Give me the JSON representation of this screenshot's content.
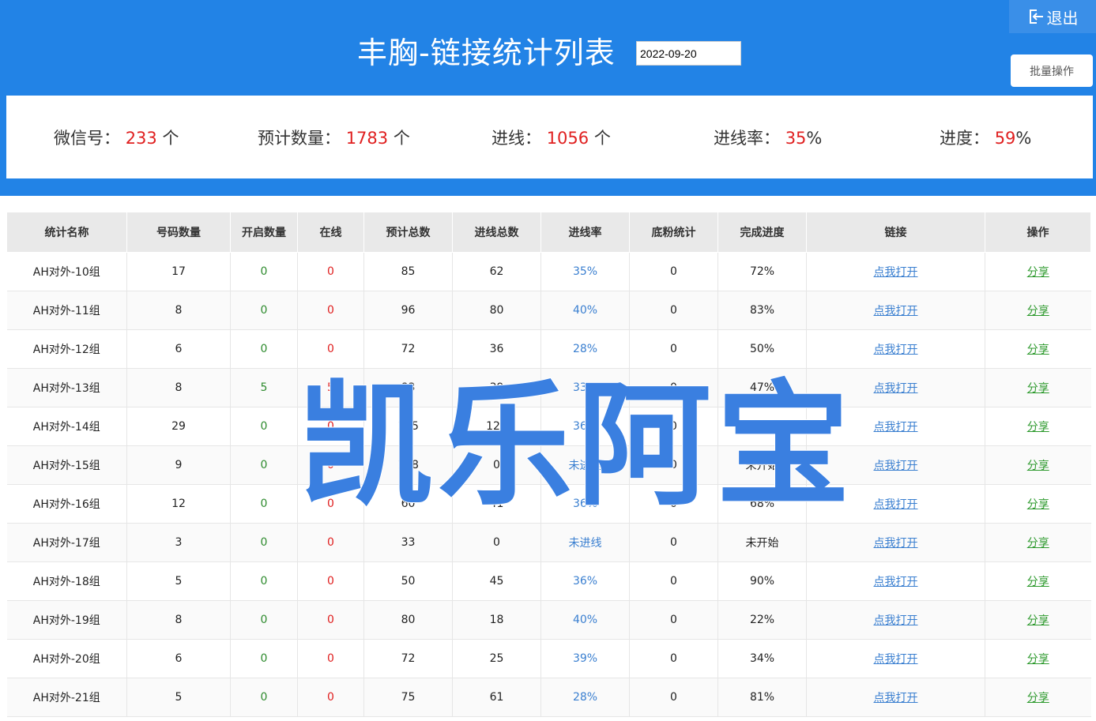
{
  "header": {
    "title": "丰胸-链接统计列表",
    "date_value": "2022-09-20",
    "logout_label": "退出",
    "logout_icon": "logout-icon",
    "batch_label": "批量操作",
    "bg_color": "#2283e6"
  },
  "stats": [
    {
      "label": "微信号：",
      "value": "233",
      "unit": "个"
    },
    {
      "label": "预计数量：",
      "value": "1783",
      "unit": "个"
    },
    {
      "label": "进线：",
      "value": "1056",
      "unit": "个"
    },
    {
      "label": "进线率：",
      "value": "35",
      "unit": "%"
    },
    {
      "label": "进度：",
      "value": "59",
      "unit": "%"
    }
  ],
  "table": {
    "columns": [
      "统计名称",
      "号码数量",
      "开启数量",
      "在线",
      "预计总数",
      "进线总数",
      "进线率",
      "底粉统计",
      "完成进度",
      "链接",
      "操作"
    ],
    "rows": [
      {
        "name": "AH对外-10组",
        "count": "17",
        "open": "0",
        "online": "0",
        "expected": "85",
        "incoming": "62",
        "rate": "35%",
        "base": "0",
        "progress": "72%",
        "link": "点我打开",
        "action": "分享"
      },
      {
        "name": "AH对外-11组",
        "count": "8",
        "open": "0",
        "online": "0",
        "expected": "96",
        "incoming": "80",
        "rate": "40%",
        "base": "0",
        "progress": "83%",
        "link": "点我打开",
        "action": "分享"
      },
      {
        "name": "AH对外-12组",
        "count": "6",
        "open": "0",
        "online": "0",
        "expected": "72",
        "incoming": "36",
        "rate": "28%",
        "base": "0",
        "progress": "50%",
        "link": "点我打开",
        "action": "分享"
      },
      {
        "name": "AH对外-13组",
        "count": "8",
        "open": "5",
        "online": "5",
        "expected": "83",
        "incoming": "39",
        "rate": "33%",
        "base": "0",
        "progress": "47%",
        "link": "点我打开",
        "action": "分享"
      },
      {
        "name": "AH对外-14组",
        "count": "29",
        "open": "0",
        "online": "0",
        "expected": "145",
        "incoming": "126",
        "rate": "36%",
        "base": "0",
        "progress": "87%",
        "link": "点我打开",
        "action": "分享"
      },
      {
        "name": "AH对外-15组",
        "count": "9",
        "open": "0",
        "online": "0",
        "expected": "108",
        "incoming": "0",
        "rate": "未进线",
        "base": "0",
        "progress": "未开始",
        "link": "点我打开",
        "action": "分享"
      },
      {
        "name": "AH对外-16组",
        "count": "12",
        "open": "0",
        "online": "0",
        "expected": "60",
        "incoming": "41",
        "rate": "36%",
        "base": "0",
        "progress": "68%",
        "link": "点我打开",
        "action": "分享"
      },
      {
        "name": "AH对外-17组",
        "count": "3",
        "open": "0",
        "online": "0",
        "expected": "33",
        "incoming": "0",
        "rate": "未进线",
        "base": "0",
        "progress": "未开始",
        "link": "点我打开",
        "action": "分享"
      },
      {
        "name": "AH对外-18组",
        "count": "5",
        "open": "0",
        "online": "0",
        "expected": "50",
        "incoming": "45",
        "rate": "36%",
        "base": "0",
        "progress": "90%",
        "link": "点我打开",
        "action": "分享"
      },
      {
        "name": "AH对外-19组",
        "count": "8",
        "open": "0",
        "online": "0",
        "expected": "80",
        "incoming": "18",
        "rate": "40%",
        "base": "0",
        "progress": "22%",
        "link": "点我打开",
        "action": "分享"
      },
      {
        "name": "AH对外-20组",
        "count": "6",
        "open": "0",
        "online": "0",
        "expected": "72",
        "incoming": "25",
        "rate": "39%",
        "base": "0",
        "progress": "34%",
        "link": "点我打开",
        "action": "分享"
      },
      {
        "name": "AH对外-21组",
        "count": "5",
        "open": "0",
        "online": "0",
        "expected": "75",
        "incoming": "61",
        "rate": "28%",
        "base": "0",
        "progress": "81%",
        "link": "点我打开",
        "action": "分享"
      }
    ]
  },
  "watermark": {
    "text": "凯乐阿宝",
    "color": "#3a7fe0"
  }
}
